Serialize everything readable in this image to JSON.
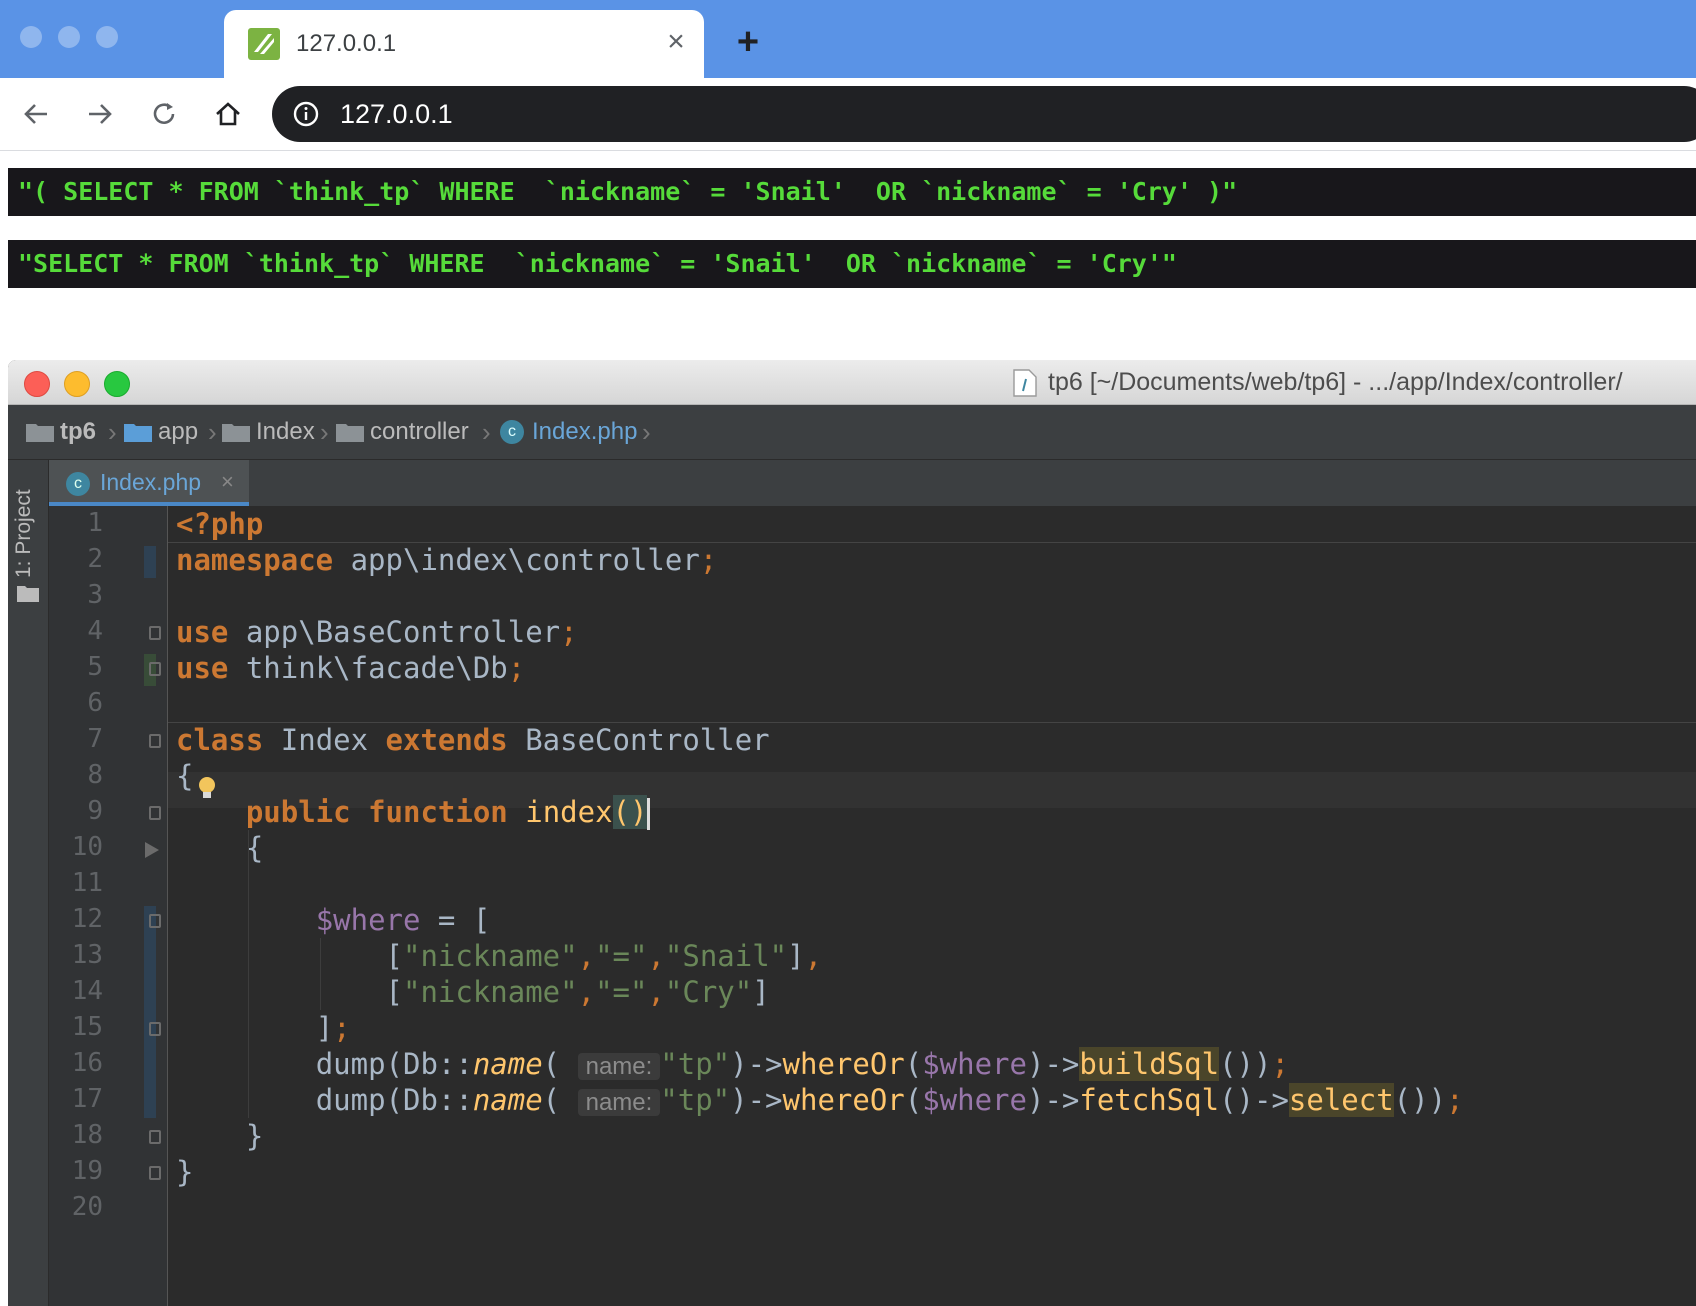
{
  "browser": {
    "tab_title": "127.0.0.1",
    "tab_close": "×",
    "new_tab": "+",
    "url": "127.0.0.1"
  },
  "dump_outputs": [
    "\"( SELECT * FROM `think_tp` WHERE  `nickname` = 'Snail'  OR `nickname` = 'Cry' )\"",
    "\"SELECT * FROM `think_tp` WHERE  `nickname` = 'Snail'  OR `nickname` = 'Cry'\""
  ],
  "ide": {
    "window_title": "tp6 [~/Documents/web/tp6] - .../app/Index/controller/",
    "breadcrumb": [
      "tp6",
      "app",
      "Index",
      "controller",
      "Index.php"
    ],
    "side_panel_label": "1: Project",
    "editor_tab": "Index.php",
    "editor_tab_close": "×",
    "line_numbers": [
      "1",
      "2",
      "3",
      "4",
      "5",
      "6",
      "7",
      "8",
      "9",
      "10",
      "11",
      "12",
      "13",
      "14",
      "15",
      "16",
      "17",
      "18",
      "19",
      "20"
    ],
    "code": {
      "l1": "<?php",
      "l2_kw": "namespace",
      "l2_rest": " app\\index\\controller",
      "l4_kw": "use",
      "l4_rest": " app\\BaseController",
      "l5_kw": "use",
      "l5_rest": " think\\facade\\Db",
      "l7_kw1": "class",
      "l7_name": " Index ",
      "l7_kw2": "extends",
      "l7_base": " BaseController",
      "l8": "{",
      "l9_kw1": "public",
      "l9_kw2": "function",
      "l9_fn": "index",
      "l9_paren": "()",
      "l10": "{",
      "l12_var": "$where",
      "l12_rest": " = [",
      "l13_open": "[",
      "l13_s1": "\"nickname\"",
      "l13_s2": "\"=\"",
      "l13_s3": "\"Snail\"",
      "l13_close": "]",
      "l14_open": "[",
      "l14_s1": "\"nickname\"",
      "l14_s2": "\"=\"",
      "l14_s3": "\"Cry\"",
      "l14_close": "]",
      "l15": "]",
      "dump": "dump(Db::",
      "name_fn": "name",
      "hint": "name:",
      "tp": "\"tp\"",
      "arrow": ")->",
      "whereOr": "whereOr",
      "where_var": "$where",
      "buildSql": "buildSql",
      "fetchSql": "fetchSql",
      "select": "select",
      "l18": "}",
      "l19": "}"
    }
  },
  "colors": {
    "tabstrip": "#5a93e6",
    "sql_green": "#56db3a",
    "keyword": "#cc7832",
    "string": "#6a8759",
    "variable": "#9876aa",
    "function": "#ffc66d"
  }
}
